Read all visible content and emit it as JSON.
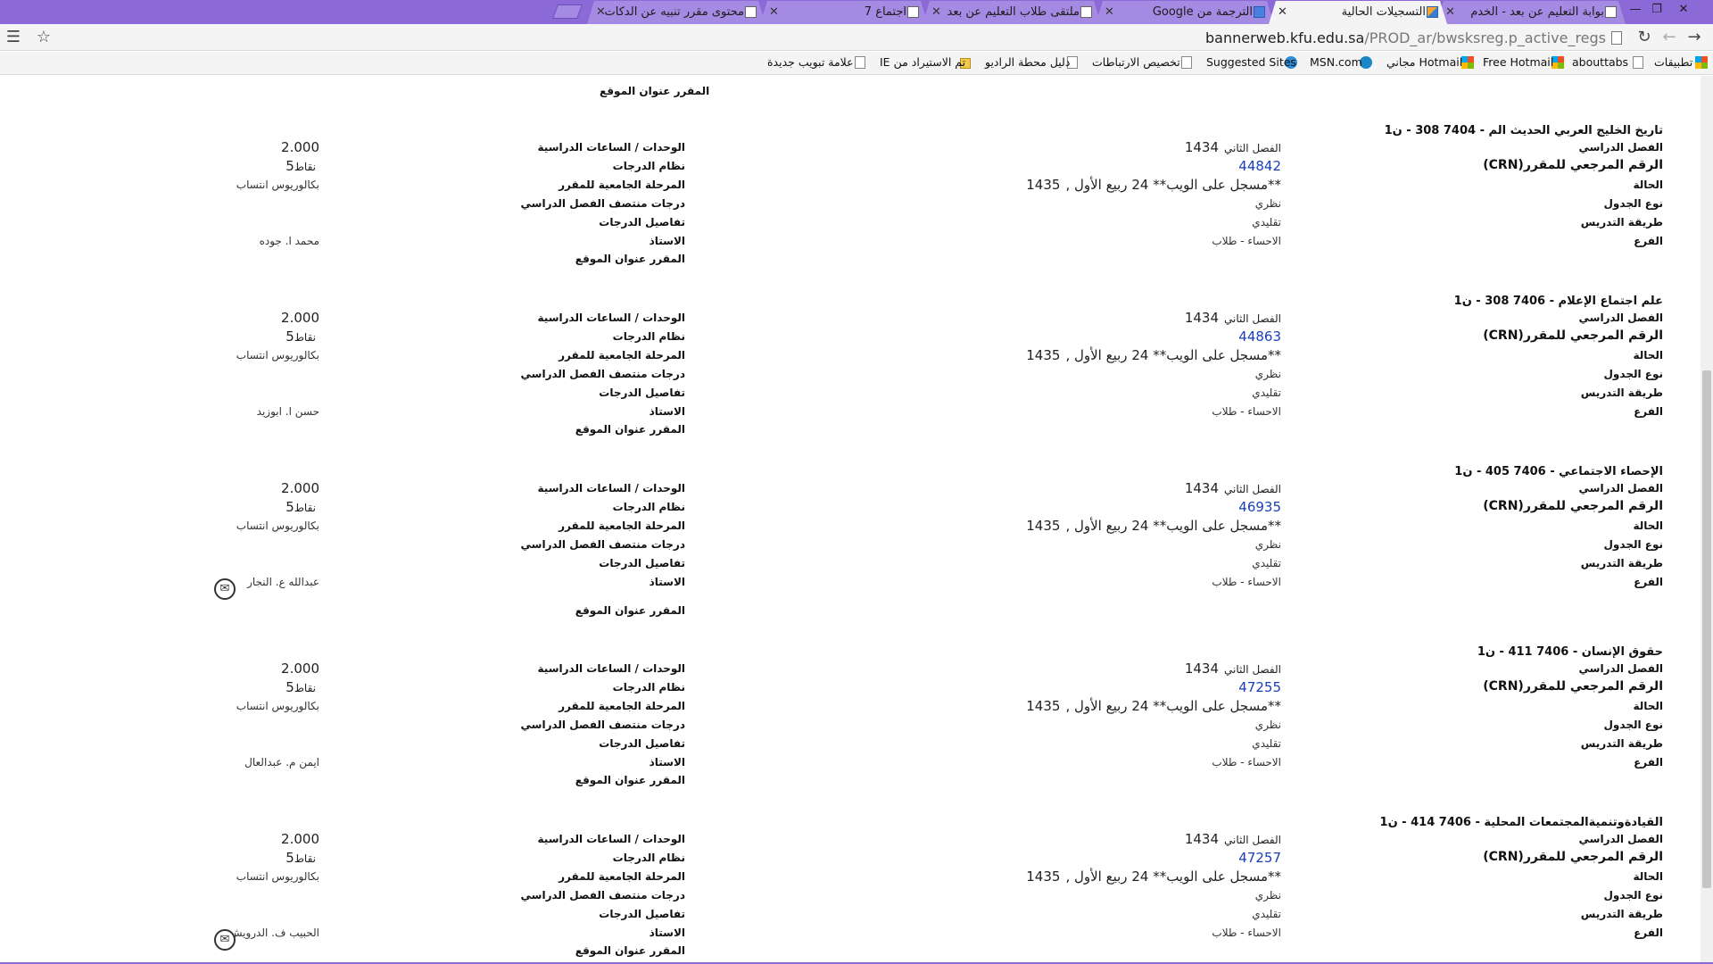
{
  "tabs": [
    {
      "label": "بوابة التعليم عن بعد - الخدم",
      "active": false
    },
    {
      "label": "التسجيلات الحالية",
      "active": true
    },
    {
      "label": "الترجمة من Google",
      "active": false
    },
    {
      "label": "ملتقى طلاب التعليم عن بعد",
      "active": false
    },
    {
      "label": "اجتماع 7",
      "active": false
    },
    {
      "label": "محتوى مقرر تنبيه عن الدكات",
      "active": false
    }
  ],
  "address": {
    "domain": "bannerweb.kfu.edu.sa",
    "path": "/PROD_ar/bwsksreg.p_active_regs"
  },
  "bookmarks": [
    "تطبيقات",
    "abouttabs",
    "Free Hotmail",
    "Hotmail مجاني",
    "MSN.com",
    "Suggested Sites",
    "تخصيص الارتباطات",
    "دليل محطة الراديو",
    "تم الاستيراد من IE",
    "علامة تبويب جديدة"
  ],
  "labels": {
    "term": "الفصل الدراسي",
    "crn": "الرقم المرجعي للمقرر(CRN)",
    "status": "الحالة",
    "schedule_type": "نوع الجدول",
    "method": "طريقة التدريس",
    "campus": "الفرع",
    "credits": "الوحدات / الساعات الدراسية",
    "grade_mode": "نظام الدرجات",
    "level": "المرحلة الجامعية للمقرر",
    "midterm": "درجات منتصف الفصل الدراسي",
    "grade_detail": "تفاصيل الدرجات",
    "instructor": "الاستاذ",
    "course_site": "المقرر عنوان الموقع"
  },
  "courses": [
    {
      "title": "تاريخ الخليج العربي الحديث الم - 7404 308 - ن1",
      "term_year": "1434",
      "term_name": "الفصل الثاني",
      "crn": "44842",
      "status_year": "1435",
      "status_text": "**مسجل على الويب** 24 ربيع الأول ,",
      "schedule_type": "نظري",
      "method": "تقليدي",
      "campus": "الاحساء - طلاب",
      "credits": "2.000",
      "grade_num": "5",
      "grade_unit": "نقاط",
      "level": "بكالوريوس انتساب",
      "instructor": "محمد ا. جوده",
      "has_mail": false
    },
    {
      "title": "علم اجتماع الإعلام - 7406 308 - ن1",
      "term_year": "1434",
      "term_name": "الفصل الثاني",
      "crn": "44863",
      "status_year": "1435",
      "status_text": "**مسجل على الويب** 24 ربيع الأول ,",
      "schedule_type": "نظري",
      "method": "تقليدي",
      "campus": "الاحساء - طلاب",
      "credits": "2.000",
      "grade_num": "5",
      "grade_unit": "نقاط",
      "level": "بكالوريوس انتساب",
      "instructor": "حسن ا. ابوزيد",
      "has_mail": false
    },
    {
      "title": "الإحصاء الاجتماعي - 7406 405 - ن1",
      "term_year": "1434",
      "term_name": "الفصل الثاني",
      "crn": "46935",
      "status_year": "1435",
      "status_text": "**مسجل على الويب** 24 ربيع الأول ,",
      "schedule_type": "نظري",
      "method": "تقليدي",
      "campus": "الاحساء - طلاب",
      "credits": "2.000",
      "grade_num": "5",
      "grade_unit": "نقاط",
      "level": "بكالوريوس انتساب",
      "instructor": "عبدالله ع. النجار",
      "has_mail": true
    },
    {
      "title": "حقوق الإنسان - 7406 411 - ن1",
      "term_year": "1434",
      "term_name": "الفصل الثاني",
      "crn": "47255",
      "status_year": "1435",
      "status_text": "**مسجل على الويب** 24 ربيع الأول ,",
      "schedule_type": "نظري",
      "method": "تقليدي",
      "campus": "الاحساء - طلاب",
      "credits": "2.000",
      "grade_num": "5",
      "grade_unit": "نقاط",
      "level": "بكالوريوس انتساب",
      "instructor": "ايمن م. عبدالعال",
      "has_mail": false
    },
    {
      "title": "القيادةوتنميةالمجتمعات المحلية - 7406 414 - ن1",
      "term_year": "1434",
      "term_name": "الفصل الثاني",
      "crn": "47257",
      "status_year": "1435",
      "status_text": "**مسجل على الويب** 24 ربيع الأول ,",
      "schedule_type": "نظري",
      "method": "تقليدي",
      "campus": "الاحساء - طلاب",
      "credits": "2.000",
      "grade_num": "5",
      "grade_unit": "نقاط",
      "level": "بكالوريوس انتساب",
      "instructor": "الحبيب ف. الدرويش",
      "has_mail": true
    }
  ]
}
